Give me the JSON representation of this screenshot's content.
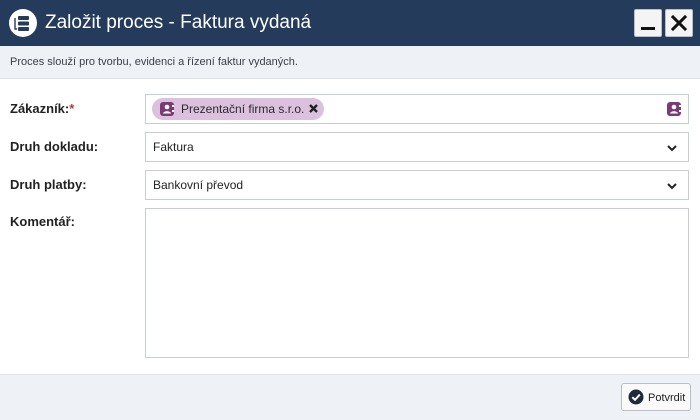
{
  "window": {
    "title": "Založit proces - Faktura vydaná",
    "description": "Proces slouží pro tvorbu, evidenci a řízení faktur vydaných."
  },
  "form": {
    "customer": {
      "label": "Zákazník:",
      "required_mark": "*",
      "chip": "Prezentační firma s.r.o."
    },
    "document_type": {
      "label": "Druh dokladu:",
      "value": "Faktura"
    },
    "payment_type": {
      "label": "Druh platby:",
      "value": "Bankovní převod"
    },
    "comment": {
      "label": "Komentář:",
      "value": ""
    }
  },
  "footer": {
    "confirm_label": "Potvrdit"
  },
  "colors": {
    "titlebar": "#253b5c",
    "chip_background": "#dbc1dd",
    "contact_icon": "#7b3a77",
    "infobar": "#eef1f6"
  },
  "icons": {
    "app": "process-icon",
    "minimize": "minimize-icon",
    "close": "close-icon",
    "chip": "contact-card-icon",
    "chip_remove": "remove-x-icon",
    "picker": "contact-card-icon",
    "dropdown": "chevron-down-icon",
    "confirm": "check-circle-icon"
  }
}
